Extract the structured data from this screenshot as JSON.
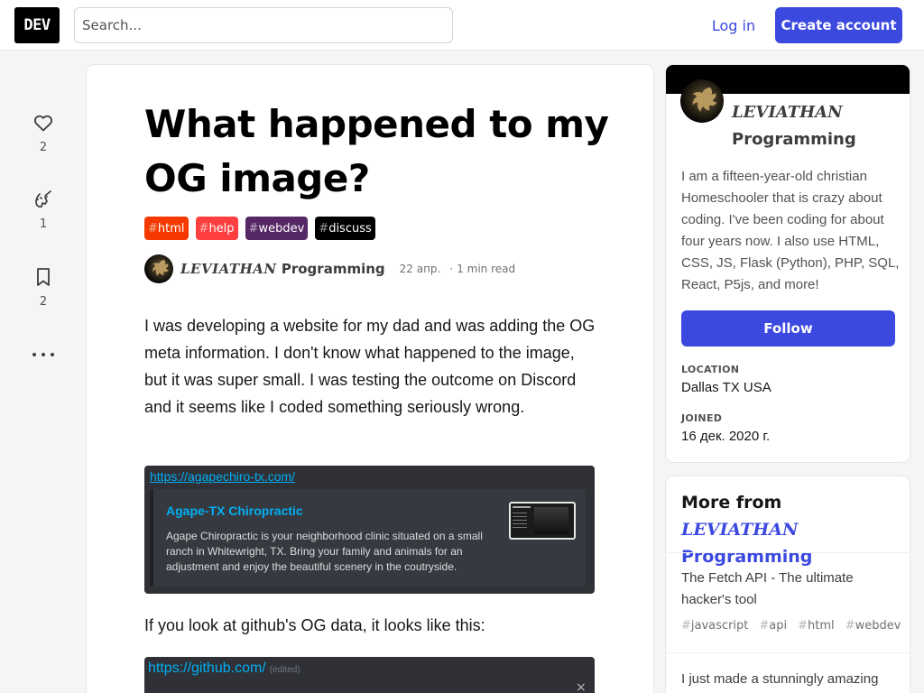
{
  "header": {
    "logo": "DEV",
    "search_placeholder": "Search...",
    "login": "Log in",
    "create_account": "Create account"
  },
  "reactions": {
    "likes": "2",
    "unicorns": "1",
    "bookmarks": "2"
  },
  "article": {
    "title": "What happened to my OG image?",
    "tags": [
      {
        "name": "html",
        "color": "#f53900"
      },
      {
        "name": "help",
        "color": "#ff3f3f"
      },
      {
        "name": "webdev",
        "color": "#562765"
      },
      {
        "name": "discuss",
        "color": "#000000"
      }
    ],
    "author_lev": "LEVIATHAN",
    "author_rest": " Programming",
    "date": "22 апр.",
    "read_time": "1 min read",
    "para1": "I was developing a website for my dad and was adding the OG meta information. I don't know what happened to the image, but it was super small. I was testing the outcome on Discord and it seems like I coded something seriously wrong.",
    "embed1": {
      "link": "https://agapechiro-tx.com/",
      "title": "Agape-TX Chiropractic",
      "description": "Agape Chiropractic is your neighborhood clinic situated on a small ranch in Whitewright, TX. Bring your family and animals for an adjustment and enjoy the beautiful scenery in the coutryside."
    },
    "para2": "If you look at github's OG data, it looks like this:",
    "embed2": {
      "link": "https://github.com/",
      "edited": "(edited)",
      "close": "×"
    }
  },
  "profile": {
    "name_lev": "LEVIATHAN",
    "name_rest": "Programming",
    "bio": "I am a fifteen-year-old christian Homeschooler that is crazy about coding. I've been coding for about four years now. I also use HTML, CSS, JS, Flask (Python), PHP, SQL, React, P5js, and more!",
    "follow": "Follow",
    "location_label": "LOCATION",
    "location": "Dallas TX USA",
    "joined_label": "JOINED",
    "joined": "16 дек. 2020 г."
  },
  "more_from": {
    "heading_prefix": "More from ",
    "author_lev": "LEVIATHAN",
    "author_rest": "Programming",
    "items": [
      {
        "title": "The Fetch API - The ultimate hacker's tool",
        "tags": [
          "javascript",
          "api",
          "html",
          "webdev"
        ]
      },
      {
        "title": "I just made a stunningly amazing"
      }
    ]
  }
}
